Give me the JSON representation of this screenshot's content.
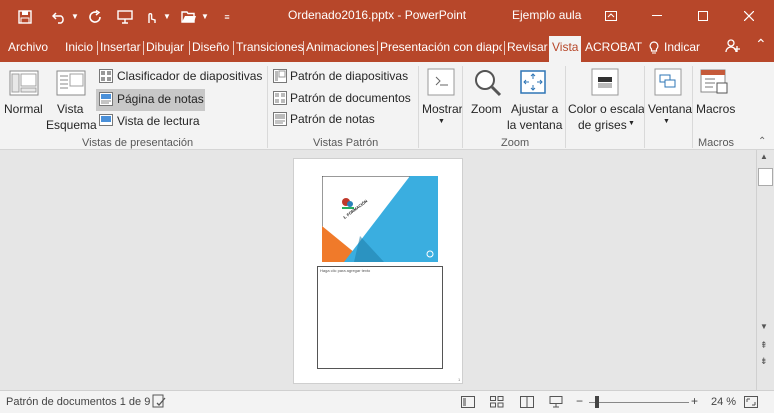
{
  "window": {
    "title": "Ordenado2016.pptx  -  PowerPoint",
    "user": "Ejemplo aula"
  },
  "tabs": [
    "Archivo",
    "Inicio",
    "Insertar",
    "Dibujar",
    "Diseño",
    "Transiciones",
    "Animaciones",
    "Presentación con diapc",
    "Revisar",
    "Vista",
    "ACROBAT",
    "Indicar"
  ],
  "active_tab": "Vista",
  "ribbon": {
    "vistas_presentacion": {
      "normal": "Normal",
      "vista_esquema_1": "Vista",
      "vista_esquema_2": "Esquema",
      "clasificador": "Clasificador de diapositivas",
      "pagina_notas": "Página de notas",
      "vista_lectura": "Vista de lectura",
      "group_label": "Vistas de presentación"
    },
    "vistas_patron": {
      "patron_diapositivas": "Patrón de diapositivas",
      "patron_documentos": "Patrón de documentos",
      "patron_notas": "Patrón de notas",
      "group_label": "Vistas Patrón"
    },
    "mostrar": {
      "label": "Mostrar"
    },
    "zoom": {
      "zoom": "Zoom",
      "ajustar_1": "Ajustar a",
      "ajustar_2": "la ventana",
      "group_label": "Zoom"
    },
    "color": {
      "label_1": "Color o escala",
      "label_2": "de grises"
    },
    "ventana": {
      "label": "Ventana"
    },
    "macros": {
      "label": "Macros",
      "group_label": "Macros"
    }
  },
  "notes_page": {
    "slide_title": "1. FORMACIÓN",
    "slide_subtitle": "AULACLIC",
    "notes_placeholder": "Haga clic para agregar texto"
  },
  "status": {
    "text": "Patrón de documentos 1 de 9",
    "zoom": "24 %"
  },
  "colors": {
    "accent": "#b7472a",
    "slide_blue": "#3aaee0",
    "slide_orange": "#f07a2a"
  }
}
